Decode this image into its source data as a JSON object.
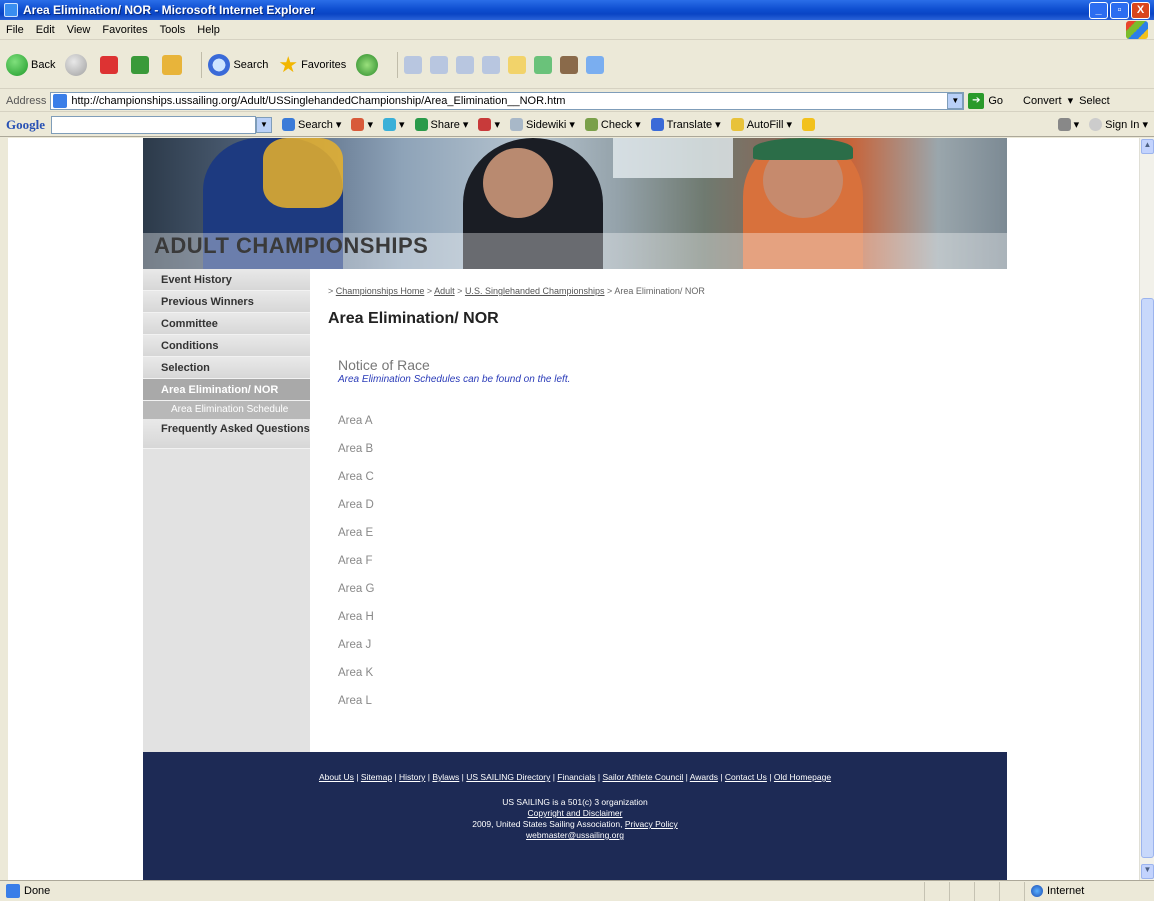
{
  "window": {
    "title": "Area Elimination/ NOR - Microsoft Internet Explorer",
    "minimize": "_",
    "maximize": "▫",
    "close": "X"
  },
  "menu": [
    "File",
    "Edit",
    "View",
    "Favorites",
    "Tools",
    "Help"
  ],
  "toolbar": {
    "back": "Back",
    "search": "Search",
    "favorites": "Favorites"
  },
  "address": {
    "label": "Address",
    "url": "http://championships.ussailing.org/Adult/USSinglehandedChampionship/Area_Elimination__NOR.htm",
    "go": "Go",
    "convert": "Convert",
    "select": "Select"
  },
  "google": {
    "logo": "Google",
    "search": "Search",
    "share": "Share",
    "sidewiki": "Sidewiki",
    "check": "Check",
    "translate": "Translate",
    "autofill": "AutoFill",
    "sign_in": "Sign In"
  },
  "banner": {
    "title": "ADULT CHAMPIONSHIPS"
  },
  "sidebar": {
    "items": [
      "Event History",
      "Previous Winners",
      "Committee",
      "Conditions",
      "Selection",
      "Area Elimination/ NOR",
      "Area Elimination Schedule",
      "Frequently Asked Questions"
    ]
  },
  "breadcrumb": {
    "prefix": ">",
    "home": "Championships Home",
    "sep": ">",
    "adult": "Adult",
    "event": "U.S. Singlehanded Championships",
    "current": "Area Elimination/ NOR"
  },
  "main": {
    "title": "Area Elimination/ NOR",
    "section_title": "Notice of Race",
    "section_note": "Area Elimination Schedules can be found on the left.",
    "areas": [
      "Area A",
      "Area B",
      "Area C",
      "Area D",
      "Area E",
      "Area F",
      "Area G",
      "Area H",
      "Area J",
      "Area K",
      "Area L"
    ]
  },
  "footer": {
    "links": [
      "About Us",
      "Sitemap",
      "History",
      "Bylaws",
      "US SAILING Directory",
      "Financials",
      "Sailor Athlete Council",
      "Awards",
      "Contact Us",
      "Old Homepage"
    ],
    "org_line": "US SAILING is a 501(c) 3 organization",
    "copyright_link": "Copyright and Disclaimer",
    "year_line": "2009, United States Sailing Association,",
    "privacy_link": "Privacy Policy",
    "email": "webmaster@ussailing.org"
  },
  "status": {
    "text": "Done",
    "zone": "Internet"
  }
}
